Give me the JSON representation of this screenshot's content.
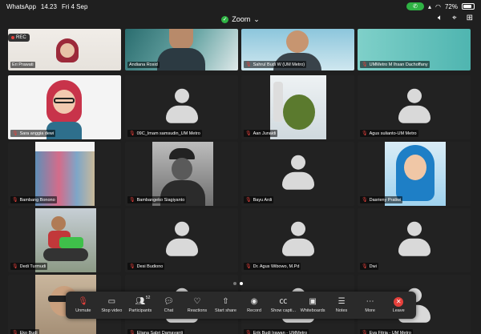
{
  "status": {
    "app": "WhatsApp",
    "time": "14.23",
    "date": "Fri 4 Sep",
    "battery": "72%"
  },
  "header": {
    "title": "Zoom"
  },
  "rec_label": "REC",
  "participants": [
    {
      "name": "Eri Prawati",
      "muted": false,
      "video": "woman-hijab"
    },
    {
      "name": "Andiana Rosid",
      "muted": false,
      "video": "man-bg"
    },
    {
      "name": "Sahrul Budi W (UM Metro)",
      "muted": true,
      "video": "man-glasses"
    },
    {
      "name": "UMMetro M Ihsan Dachoffany",
      "muted": true,
      "video": "teal"
    },
    {
      "name": "Sara anggia dewi",
      "muted": true,
      "video": "avatar-3d"
    },
    {
      "name": "09C_Imam samsudin_UM Metro",
      "muted": true,
      "video": "none"
    },
    {
      "name": "Aan Junaidi",
      "muted": true,
      "video": "photo-plant"
    },
    {
      "name": "Agus sulianto-UM Metro",
      "muted": true,
      "video": "none"
    },
    {
      "name": "Bambang Bonono",
      "muted": true,
      "video": "shop"
    },
    {
      "name": "Bambangeko Siagiyanto",
      "muted": true,
      "video": "bw-man"
    },
    {
      "name": "Bayu Ardi",
      "muted": true,
      "video": "none"
    },
    {
      "name": "Dasrieny Pratiwi",
      "muted": true,
      "video": "hijab-blue"
    },
    {
      "name": "Dedi Turmudi",
      "muted": true,
      "video": "motorbike"
    },
    {
      "name": "Desi Budiono",
      "muted": true,
      "video": "none"
    },
    {
      "name": "Dr. Agus Wibowo, M.Pd",
      "muted": true,
      "video": "none"
    },
    {
      "name": "Dwi",
      "muted": true,
      "video": "none"
    },
    {
      "name": "Eko Budi",
      "muted": true,
      "video": "boy"
    },
    {
      "name": "Eliana Sabri Damayanti",
      "muted": true,
      "video": "none"
    },
    {
      "name": "Erik Budi Irawan - UMMetro",
      "muted": true,
      "video": "none"
    },
    {
      "name": "Eva Fitria - UM Metro",
      "muted": true,
      "video": "none"
    }
  ],
  "toolbar": {
    "unmute": "Unmute",
    "stop_video": "Stop video",
    "participants": "Participants",
    "participants_count": "52",
    "chat": "Chat",
    "reactions": "Reactions",
    "start_share": "Start share",
    "record": "Record",
    "show_captions": "Show capti...",
    "whiteboards": "Whiteboards",
    "notes": "Notes",
    "more": "More",
    "leave": "Leave"
  },
  "colors": {
    "accent_green": "#2fb344",
    "muted_red": "#e5403b",
    "tile_bg": "#222222"
  }
}
